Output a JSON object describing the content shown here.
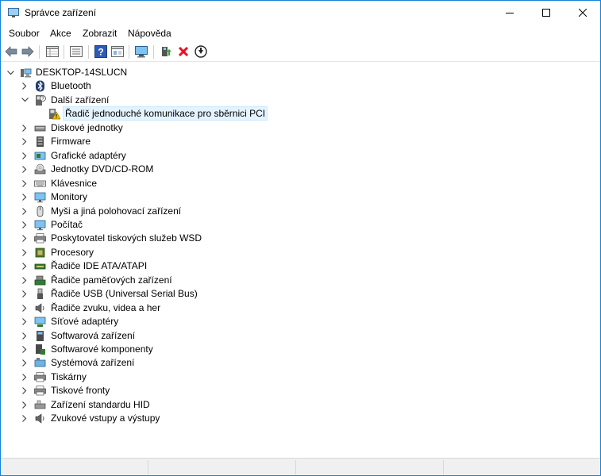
{
  "window": {
    "title": "Správce zařízení"
  },
  "menu": {
    "items": [
      "Soubor",
      "Akce",
      "Zobrazit",
      "Nápověda"
    ]
  },
  "toolbar": {
    "buttons": [
      "back-icon",
      "forward-icon",
      "properties-grid-icon",
      "show-list-icon",
      "help-icon",
      "console-icon",
      "monitor-scan-icon",
      "update-driver-icon",
      "uninstall-icon",
      "disable-icon"
    ]
  },
  "tree": {
    "root": "DESKTOP-14SLUCN",
    "items": [
      {
        "label": "Bluetooth",
        "icon": "bluetooth-icon",
        "expanded": false
      },
      {
        "label": "Další zařízení",
        "icon": "unknown-device-icon",
        "expanded": true
      },
      {
        "label": "Řadič jednoduché komunikace pro sběrnici PCI",
        "icon": "warning-device-icon",
        "child": true,
        "selected": true
      },
      {
        "label": "Diskové jednotky",
        "icon": "disk-icon",
        "expanded": false
      },
      {
        "label": "Firmware",
        "icon": "firmware-icon",
        "expanded": false
      },
      {
        "label": "Grafické adaptéry",
        "icon": "display-adapter-icon",
        "expanded": false
      },
      {
        "label": "Jednotky DVD/CD-ROM",
        "icon": "dvd-icon",
        "expanded": false
      },
      {
        "label": "Klávesnice",
        "icon": "keyboard-icon",
        "expanded": false
      },
      {
        "label": "Monitory",
        "icon": "monitor-icon",
        "expanded": false
      },
      {
        "label": "Myši a jiná polohovací zařízení",
        "icon": "mouse-icon",
        "expanded": false
      },
      {
        "label": "Počítač",
        "icon": "computer-icon",
        "expanded": false
      },
      {
        "label": "Poskytovatel tiskových služeb WSD",
        "icon": "printer-icon",
        "expanded": false
      },
      {
        "label": "Procesory",
        "icon": "processor-icon",
        "expanded": false
      },
      {
        "label": "Řadiče IDE ATA/ATAPI",
        "icon": "ide-icon",
        "expanded": false
      },
      {
        "label": "Řadiče paměťových zařízení",
        "icon": "storage-controller-icon",
        "expanded": false
      },
      {
        "label": "Řadiče USB (Universal Serial Bus)",
        "icon": "usb-icon",
        "expanded": false
      },
      {
        "label": "Řadiče zvuku, videa a her",
        "icon": "speaker-icon",
        "expanded": false
      },
      {
        "label": "Síťové adaptéry",
        "icon": "network-icon",
        "expanded": false
      },
      {
        "label": "Softwarová zařízení",
        "icon": "software-device-icon",
        "expanded": false
      },
      {
        "label": "Softwarové komponenty",
        "icon": "software-component-icon",
        "expanded": false
      },
      {
        "label": "Systémová zařízení",
        "icon": "system-device-icon",
        "expanded": false
      },
      {
        "label": "Tiskárny",
        "icon": "printer-icon",
        "expanded": false
      },
      {
        "label": "Tiskové fronty",
        "icon": "print-queue-icon",
        "expanded": false
      },
      {
        "label": "Zařízení standardu HID",
        "icon": "hid-icon",
        "expanded": false
      },
      {
        "label": "Zvukové vstupy a výstupy",
        "icon": "audio-io-icon",
        "expanded": false
      }
    ]
  },
  "colors": {
    "border": "#1883d7",
    "selection": "#e5f3ff",
    "warning": "#f2c200",
    "delete": "#e81123"
  }
}
